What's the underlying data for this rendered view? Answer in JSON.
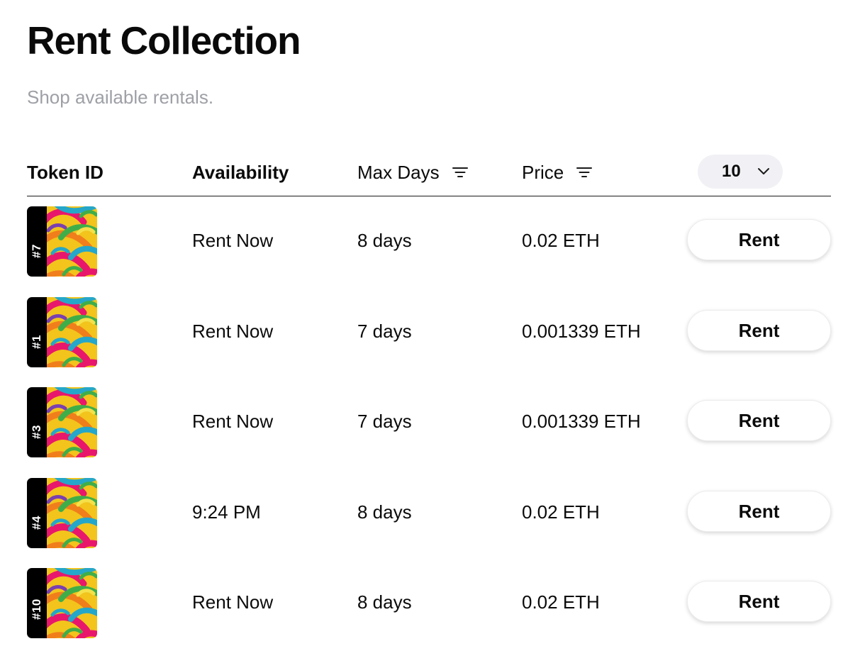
{
  "page": {
    "title": "Rent Collection",
    "subtitle": "Shop available rentals."
  },
  "table": {
    "headers": {
      "token_id": "Token ID",
      "availability": "Availability",
      "max_days": "Max Days",
      "price": "Price"
    },
    "page_size": {
      "selected": "10"
    },
    "rows": [
      {
        "token_label": "#7",
        "availability": "Rent Now",
        "max_days": "8 days",
        "price": "0.02 ETH",
        "action": "Rent"
      },
      {
        "token_label": "#1",
        "availability": "Rent Now",
        "max_days": "7 days",
        "price": "0.001339 ETH",
        "action": "Rent"
      },
      {
        "token_label": "#3",
        "availability": "Rent Now",
        "max_days": "7 days",
        "price": "0.001339 ETH",
        "action": "Rent"
      },
      {
        "token_label": "#4",
        "availability": "9:24 PM",
        "max_days": "8 days",
        "price": "0.02 ETH",
        "action": "Rent"
      },
      {
        "token_label": "#10",
        "availability": "Rent Now",
        "max_days": "8 days",
        "price": "0.02 ETH",
        "action": "Rent"
      }
    ]
  },
  "icons": {
    "filter": "filter-lines-icon",
    "dropdown": "chevron-down-icon",
    "thumbnail": "abstract-art-thumbnail"
  },
  "colors": {
    "subtitle": "#9ea0a6",
    "page_size_bg": "#f1f1f5",
    "thumb_label_bg": "#000000"
  }
}
